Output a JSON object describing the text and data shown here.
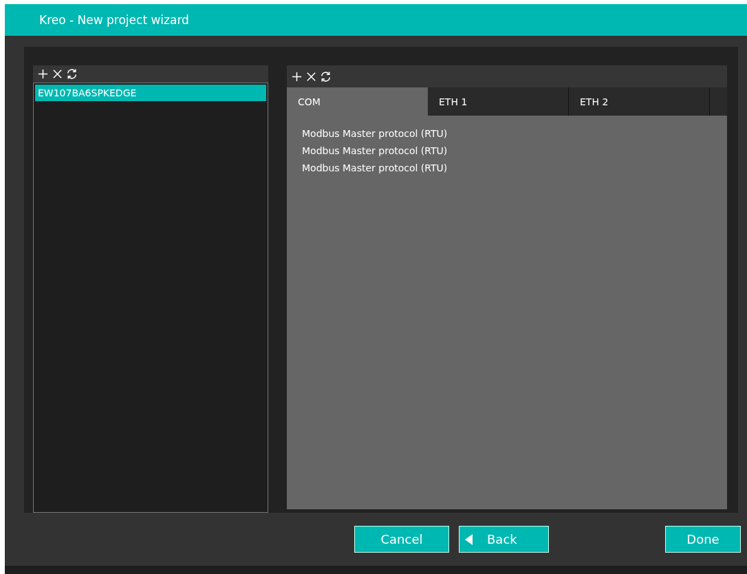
{
  "window": {
    "title": "Kreo - New project wizard"
  },
  "devices": {
    "items": [
      {
        "label": "EW107BA6SPKEDGE",
        "selected": true
      }
    ]
  },
  "ports": {
    "tabs": [
      {
        "label": "COM",
        "selected": true
      },
      {
        "label": "ETH 1",
        "selected": false
      },
      {
        "label": "ETH 2",
        "selected": false
      }
    ],
    "protocols": [
      "Modbus Master protocol (RTU)",
      "Modbus Master protocol (RTU)",
      "Modbus Master protocol (RTU)"
    ]
  },
  "buttons": [
    {
      "kind": "cancel",
      "label": "Cancel"
    },
    {
      "kind": "back",
      "label": "Back"
    },
    {
      "kind": "done",
      "label": "Done"
    }
  ]
}
